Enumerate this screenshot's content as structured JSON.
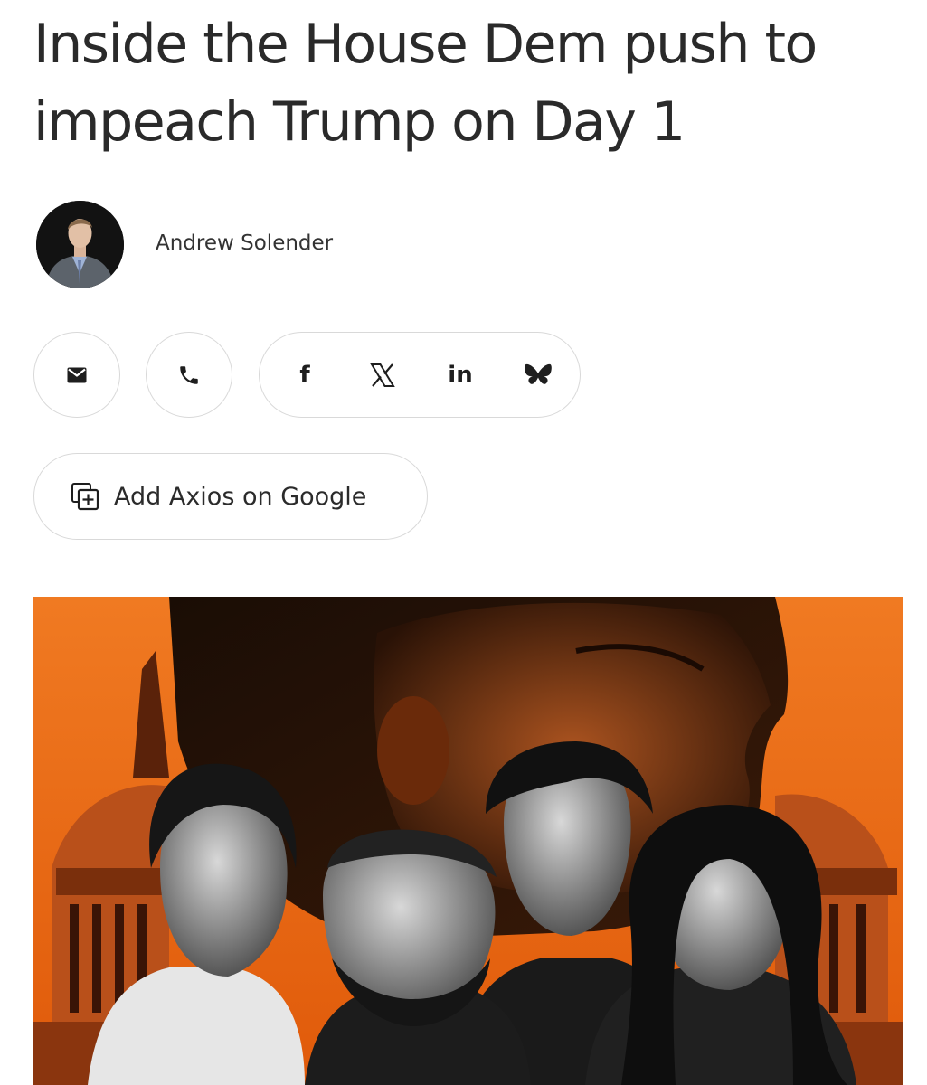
{
  "article": {
    "headline": "Inside the House Dem push to impeach Trump on Day 1",
    "author": "Andrew Solender"
  },
  "share": {
    "email_icon": "email-icon",
    "phone_icon": "phone-icon",
    "facebook_label": "f",
    "x_icon": "x-icon",
    "linkedin_label": "in",
    "bluesky_icon": "bluesky-butterfly-icon"
  },
  "follow": {
    "add_google_label": "Add Axios on Google",
    "icon": "add-source-icon"
  },
  "hero_image": {
    "description_icon": "photo-illustration",
    "accent_color": "#e8620f"
  },
  "colors": {
    "text": "#2a2a2a",
    "pill_border": "#d9d9d9",
    "hero_orange": "#e8620f"
  }
}
